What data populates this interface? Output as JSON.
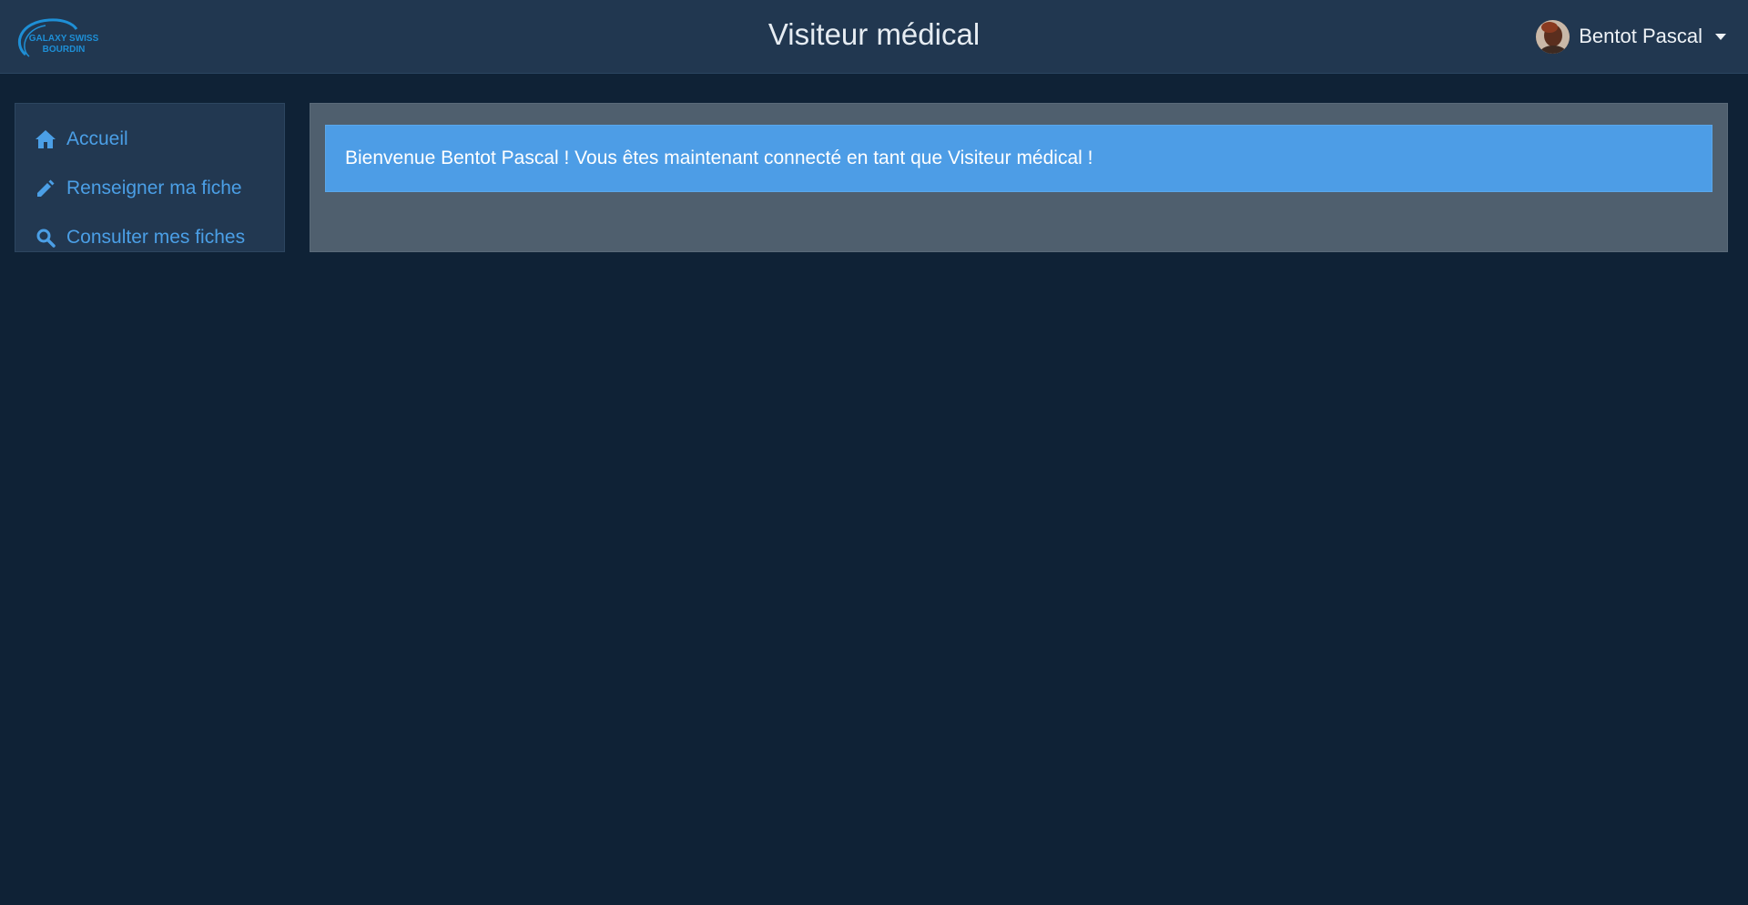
{
  "header": {
    "logo_text": "GALAXY SWISS BOURDIN",
    "title": "Visiteur médical",
    "user": {
      "name": "Bentot Pascal"
    }
  },
  "sidebar": {
    "items": [
      {
        "label": "Accueil",
        "icon": "home-icon"
      },
      {
        "label": "Renseigner ma fiche",
        "icon": "pencil-icon"
      },
      {
        "label": "Consulter mes fiches",
        "icon": "search-icon"
      }
    ]
  },
  "main": {
    "welcome_message": "Bienvenue Bentot Pascal ! Vous êtes maintenant connecté en tant que Visiteur médical !"
  },
  "colors": {
    "background": "#0f2236",
    "header": "#213750",
    "link": "#4b9fe6",
    "alert": "#4d9de6",
    "panel": "#4f5f6e"
  }
}
